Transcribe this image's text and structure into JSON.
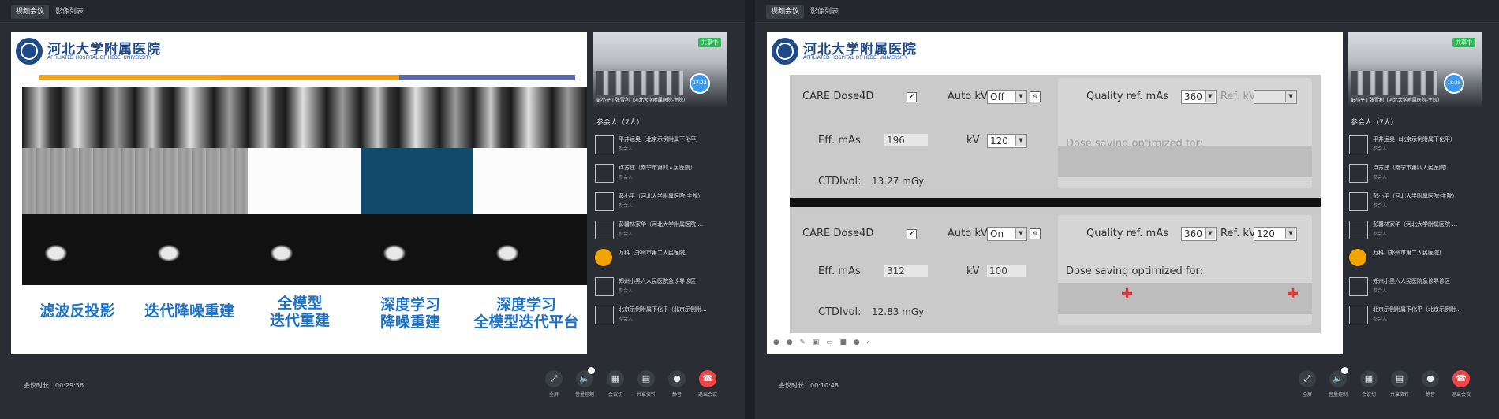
{
  "panes": [
    {
      "tabs": [
        "视频会议",
        "影像列表"
      ],
      "active_tab": 0,
      "slide": {
        "hospital_cn": "河北大学附属医院",
        "hospital_en": "AFFILIATED HOSPITAL OF HEBEI UNIVERSITY",
        "labels": [
          "滤波反投影",
          "迭代降噪重建",
          "全模型\n迭代重建",
          "深度学习\n降噪重建",
          "深度学习\n全模型迭代平台"
        ]
      },
      "camera": {
        "status": "共享中",
        "caption": "彭小平 | 张雪利（河北大学附属医院-主院）",
        "badge": "17:23"
      },
      "participants_title": "参会人（7人）",
      "participants": [
        {
          "name": "平井运奥（北京示例附属下化平）",
          "role": "参会人"
        },
        {
          "name": "卢苏建（南宁市第四人民医院）",
          "role": "参会人"
        },
        {
          "name": "彭小平（河北大学附属医院-主院）",
          "role": "参会人"
        },
        {
          "name": "彭馨林家华（河北大学附属医院-...",
          "role": "参会人"
        },
        {
          "name": "万科（郑州市第二人民医院）",
          "role": ""
        },
        {
          "name": "郑州小黑六人民医院急诊导诊区",
          "role": "参会人"
        },
        {
          "name": "北京示例附属下化平（北京示例附...",
          "role": "参会人"
        }
      ],
      "duration": "会议时长：00:29:56",
      "controls": [
        "全屏",
        "音量控制",
        "会议切",
        "共享资料",
        "静音",
        "退出会议"
      ]
    },
    {
      "tabs": [
        "视频会议",
        "影像列表"
      ],
      "active_tab": 0,
      "slide": {
        "hospital_cn": "河北大学附属医院",
        "hospital_en": "AFFILIATED HOSPITAL OF HEBEI UNIVERSITY",
        "top": {
          "care": "CARE Dose4D",
          "autokv": "Auto kV",
          "autokv_val": "Off",
          "qref": "Quality ref. mAs",
          "qref_val": "360",
          "refkv": "Ref. kV",
          "refkv_val": "",
          "effmas": "Eff. mAs",
          "effmas_val": "196",
          "kv": "kV",
          "kv_val": "120",
          "dose_opt": "Dose saving optimized for:",
          "ctdi": "CTDIvol:",
          "ctdi_val": "13.27 mGy"
        },
        "bottom": {
          "care": "CARE Dose4D",
          "autokv": "Auto kV",
          "autokv_val": "On",
          "qref": "Quality ref. mAs",
          "qref_val": "360",
          "refkv": "Ref. kV",
          "refkv_val": "120",
          "effmas": "Eff. mAs",
          "effmas_val": "312",
          "kv": "kV",
          "kv_val": "100",
          "dose_opt": "Dose saving optimized for:",
          "ctdi": "CTDIvol:",
          "ctdi_val": "12.83 mGy"
        }
      },
      "camera": {
        "status": "共享中",
        "caption": "彭小平 | 张雪利（河北大学附属医院-主院）",
        "badge": "18:25"
      },
      "participants_title": "参会人（7人）",
      "participants": [
        {
          "name": "平井运奥（北京示例附属下化平）",
          "role": "参会人"
        },
        {
          "name": "卢苏建（南宁市第四人民医院）",
          "role": "参会人"
        },
        {
          "name": "彭小平（河北大学附属医院-主院）",
          "role": "参会人"
        },
        {
          "name": "彭馨林家华（河北大学附属医院-...",
          "role": "参会人"
        },
        {
          "name": "万科（郑州市第二人民医院）",
          "role": ""
        },
        {
          "name": "郑州小黑六人民医院急诊导诊区",
          "role": "参会人"
        },
        {
          "name": "北京示例附属下化平（北京示例附...",
          "role": "参会人"
        }
      ],
      "duration": "会议时长：00:10:48",
      "controls": [
        "全屏",
        "音量控制",
        "会议切",
        "共享资料",
        "静音",
        "退出会议"
      ]
    }
  ],
  "colors": {
    "accent_blue": "#1f73c7",
    "share_green": "#2dbb55",
    "end_red": "#f04545",
    "bar_orange": "#f2a51c",
    "bar_purple": "#5a6aa8"
  },
  "icons": [
    "fullscreen-icon",
    "volume-icon",
    "layout-icon",
    "document-icon",
    "microphone-icon",
    "hangup-icon"
  ]
}
